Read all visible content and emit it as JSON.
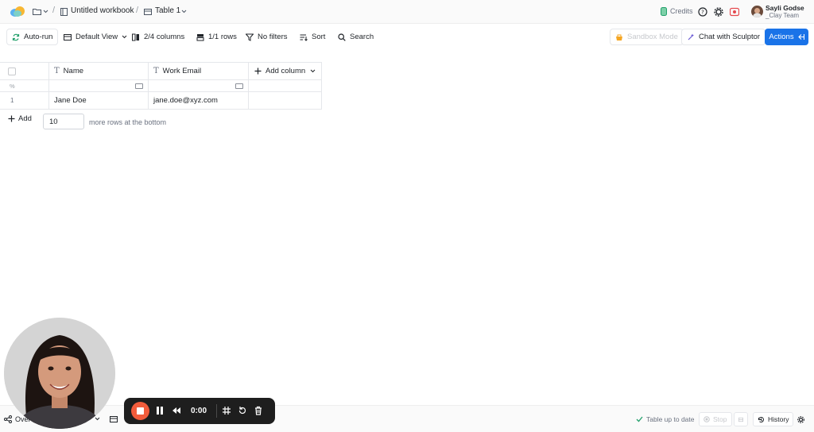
{
  "topbar": {
    "workbook_title": "Untitled workbook",
    "table_name": "Table 1",
    "separator": "/",
    "credits_label": "Credits",
    "user_name": "Sayli Godse",
    "user_team": "_Clay Team"
  },
  "toolbar": {
    "autorun": "Auto-run",
    "view": "Default View",
    "columns": "2/4 columns",
    "rows": "1/1 rows",
    "filters": "No filters",
    "sort": "Sort",
    "search": "Search",
    "sandbox": "Sandbox Mode",
    "chat": "Chat with Sculptor",
    "actions": "Actions"
  },
  "table": {
    "columns": [
      {
        "name": "Name"
      },
      {
        "name": "Work Email"
      }
    ],
    "add_column_label": "Add column",
    "subheader_symbol": "%",
    "rows": [
      {
        "index": "1",
        "name": "Jane Doe",
        "email": "jane.doe@xyz.com"
      }
    ]
  },
  "add_rows": {
    "button_label": "Add",
    "count": "10",
    "suffix": "more rows at the bottom"
  },
  "bottombar": {
    "overview_label": "Over",
    "status": "Table up to date",
    "stop_label": "Stop",
    "history_label": "History"
  },
  "recorder": {
    "time": "0:00"
  },
  "colors": {
    "accent": "#1a73e8",
    "record": "#f25c3c",
    "autorun_icon": "#22a06b",
    "sandbox_icon": "#f5a623"
  }
}
